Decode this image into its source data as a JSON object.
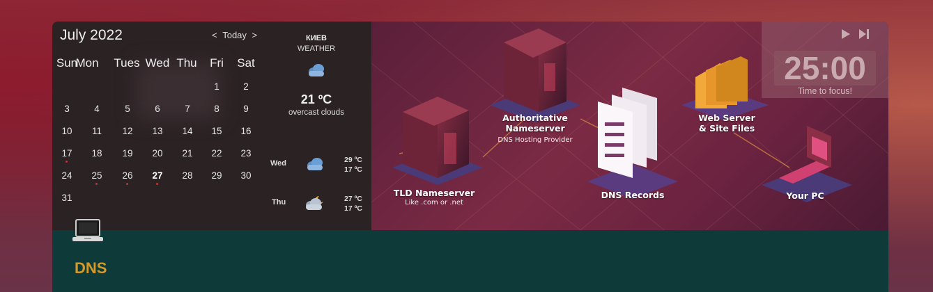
{
  "calendar": {
    "title": "July 2022",
    "nav": {
      "prev": "<",
      "today": "Today",
      "next": ">"
    },
    "weekdays": [
      "Sun",
      "Mon",
      "Tues",
      "Wed",
      "Thu",
      "Fri",
      "Sat"
    ],
    "days": [
      "1",
      "2",
      "3",
      "4",
      "5",
      "6",
      "7",
      "8",
      "9",
      "10",
      "11",
      "12",
      "13",
      "14",
      "15",
      "16",
      "17",
      "18",
      "19",
      "20",
      "21",
      "22",
      "23",
      "24",
      "25",
      "26",
      "27",
      "28",
      "29",
      "30",
      "31"
    ],
    "today": "27",
    "event_days": [
      "17",
      "25",
      "26",
      "27"
    ],
    "event_dot_color": "#d32f2f"
  },
  "weather": {
    "city": "КИЕВ",
    "subtitle": "WEATHER",
    "current_icon": "cloud-icon",
    "temperature": "21 ºC",
    "description": "overcast clouds",
    "forecast": [
      {
        "day": "Wed",
        "icon": "cloud-icon",
        "high": "29 ºC",
        "low": "17 ºC"
      },
      {
        "day": "Thu",
        "icon": "partly-cloudy-night-icon",
        "high": "27 ºC",
        "low": "17 ºC"
      }
    ]
  },
  "banner": {
    "labels": {
      "authoritative": "Authoritative\nNameserver",
      "authoritative_sub": "DNS Hosting Provider",
      "webserver": "Web Server\n& Site Files",
      "tld": "TLD Nameserver",
      "tld_sub": "Like .com or .net",
      "records": "DNS Records",
      "pc": "Your PC"
    }
  },
  "pomodoro": {
    "time": "25:00",
    "label": "Time to focus!",
    "play_icon": "play-icon",
    "skip_icon": "skip-next-icon"
  },
  "note": {
    "icon": "laptop-icon",
    "title": "DNS"
  },
  "colors": {
    "accent_title": "#d39a2a",
    "bottom_bg": "#0f3a3a",
    "panel_bg": "#2b2224"
  }
}
